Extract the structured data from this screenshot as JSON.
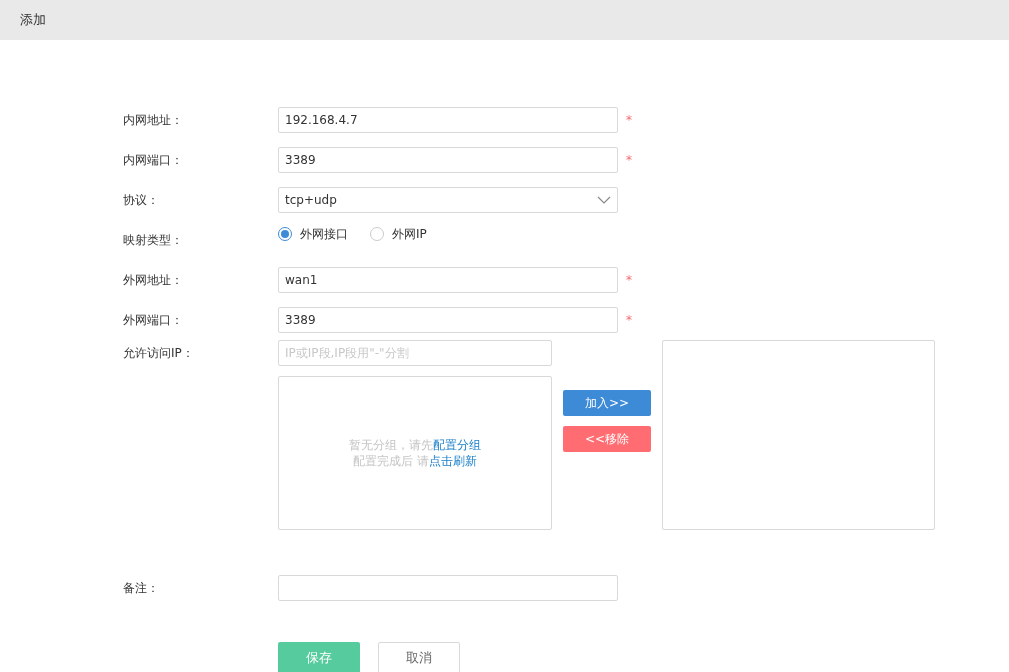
{
  "header": {
    "title": "添加"
  },
  "fields": [
    {
      "kind": "text",
      "label": "内网地址：",
      "value": "192.168.4.7",
      "required_mark": "*"
    },
    {
      "kind": "text",
      "label": "内网端口：",
      "value": "3389",
      "required_mark": "*"
    },
    {
      "kind": "select",
      "label": "协议：",
      "value": "tcp+udp"
    },
    {
      "kind": "radio",
      "label": "映射类型：",
      "options": [
        {
          "label": "外网接口",
          "selected": true
        },
        {
          "label": "外网IP",
          "selected": false
        }
      ]
    },
    {
      "kind": "text",
      "label": "外网地址：",
      "value": "wan1",
      "required_mark": "*"
    },
    {
      "kind": "text",
      "label": "外网端口：",
      "value": "3389",
      "required_mark": "*"
    }
  ],
  "access_ip": {
    "label": "允许访问IP：",
    "placeholder": "IP或IP段,IP段用\"-\"分割",
    "empty_lines": [
      {
        "text": "暂无分组，请先",
        "link": "配置分组"
      },
      {
        "text": "配置完成后 请",
        "link": "点击刷新"
      }
    ],
    "add_button": "加入>>",
    "remove_button": "<<移除"
  },
  "note": {
    "label": "备注："
  },
  "buttons": {
    "save": "保存",
    "cancel": "取消"
  }
}
